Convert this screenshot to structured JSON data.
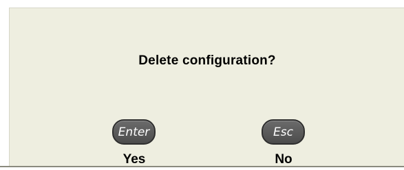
{
  "dialog": {
    "message": "Delete configuration?",
    "confirm": {
      "key_label": "Enter",
      "action_label": "Yes"
    },
    "cancel": {
      "key_label": "Esc",
      "action_label": "No"
    }
  },
  "colors": {
    "background": "#eeeee0",
    "key_fill": "#555555",
    "text": "#000000"
  }
}
